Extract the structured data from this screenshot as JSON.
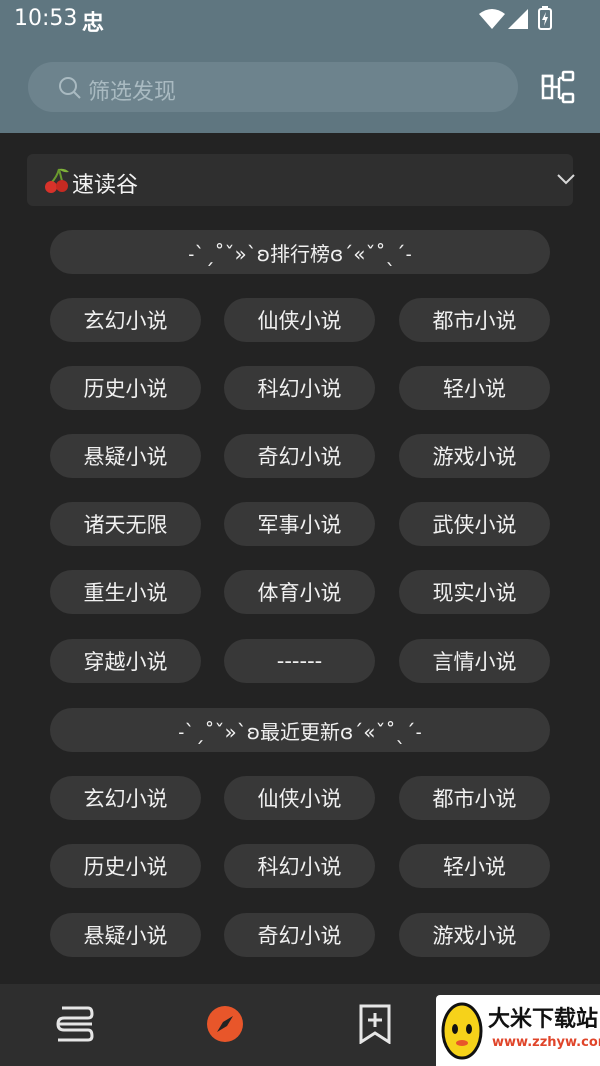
{
  "status_bar": {
    "time": "10:53",
    "app_glyph": "忠"
  },
  "search": {
    "placeholder": "筛选发现"
  },
  "source": {
    "name": "速读谷"
  },
  "sections": [
    {
      "header": "˗ˋˏ˚ˇ»`ʚ排行榜ɞ´«ˇ˚ˎˊ˗",
      "items": [
        "玄幻小说",
        "仙侠小说",
        "都市小说",
        "历史小说",
        "科幻小说",
        "轻小说",
        "悬疑小说",
        "奇幻小说",
        "游戏小说",
        "诸天无限",
        "军事小说",
        "武侠小说",
        "重生小说",
        "体育小说",
        "现实小说",
        "穿越小说",
        "------",
        "言情小说"
      ]
    },
    {
      "header": "˗ˋˏ˚ˇ»`ʚ最近更新ɞ´«ˇ˚ˎˊ˗",
      "items": [
        "玄幻小说",
        "仙侠小说",
        "都市小说",
        "历史小说",
        "科幻小说",
        "轻小说",
        "悬疑小说",
        "奇幻小说",
        "游戏小说"
      ]
    }
  ],
  "bottom_nav": {
    "items": [
      {
        "icon": "bookshelf-icon"
      },
      {
        "icon": "compass-icon",
        "active": true
      },
      {
        "icon": "bookmark-add-icon"
      }
    ]
  },
  "watermark": {
    "title": "大米下载站",
    "url": "www.zzhyw.com"
  },
  "colors": {
    "header_bg": "#5f7680",
    "body_bg": "#232323",
    "pill_bg": "#383838",
    "accent": "#e8562a"
  }
}
